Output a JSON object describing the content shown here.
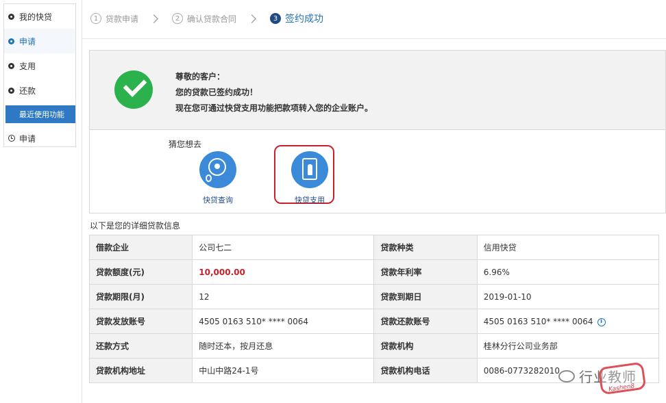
{
  "sidebar": {
    "items": [
      {
        "label": "我的快贷"
      },
      {
        "label": "申请"
      },
      {
        "label": "支用"
      },
      {
        "label": "还款"
      }
    ],
    "recent_label": "最近使用功能",
    "recent_items": [
      {
        "label": "申请"
      }
    ]
  },
  "steps": [
    {
      "num": "1",
      "label": "贷款申请"
    },
    {
      "num": "2",
      "label": "确认贷款合同"
    },
    {
      "num": "3",
      "label": "签约成功"
    }
  ],
  "success": {
    "line1": "尊敬的客户：",
    "line2": "您的贷款已签约成功！",
    "line3": "现在您可通过快贷支用功能把款项转入您的企业账户。"
  },
  "guess": {
    "title": "猜您想去",
    "query_label": "快贷查询",
    "use_label": "快贷支用"
  },
  "detail": {
    "title": "以下是您的详细贷款信息",
    "rows": [
      {
        "l1": "借款企业",
        "v1": "公司七二",
        "l2": "贷款种类",
        "v2": "信用快贷"
      },
      {
        "l1": "贷款额度(元)",
        "v1": "10,000.00",
        "l2": "贷款年利率",
        "v2": "6.96%"
      },
      {
        "l1": "贷款期限(月)",
        "v1": "12",
        "l2": "贷款到期日",
        "v2": "2019-01-10"
      },
      {
        "l1": "贷款发放账号",
        "v1": "4505 0163 510* **** 0064",
        "l2": "贷款还款账号",
        "v2": "4505 0163 510* **** 0064"
      },
      {
        "l1": "还款方式",
        "v1": "随时还本，按月还息",
        "l2": "贷款机构",
        "v2": "桂林分行公司业务部"
      },
      {
        "l1": "贷款机构地址",
        "v1": "中山中路24-1号",
        "l2": "贷款机构电话",
        "v2": "0086-0773282010"
      }
    ]
  },
  "watermark": {
    "text": "行业教师",
    "badge_text": "Kashen8"
  },
  "colors": {
    "accent": "#1f73b7",
    "success_green": "#2bb24c",
    "highlight_red": "#c8212b"
  }
}
